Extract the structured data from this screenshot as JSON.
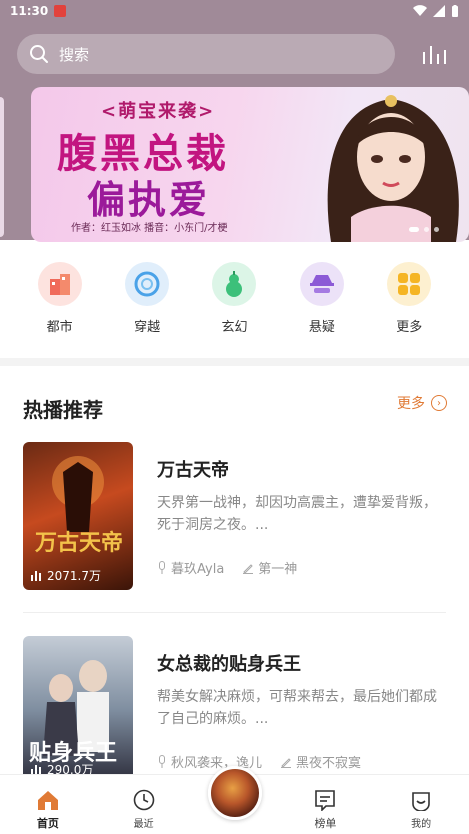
{
  "status": {
    "time": "11:30"
  },
  "search": {
    "placeholder": "搜索"
  },
  "banner": {
    "subtitle": "<萌宝来袭>",
    "title_line1": "腹黑总裁",
    "title_line2": "偏执爱",
    "credit": "作者：红玉如冰    播音：小东门/才梗"
  },
  "categories": [
    {
      "label": "都市",
      "icon": "city-icon",
      "color": "#f06a5a"
    },
    {
      "label": "穿越",
      "icon": "portal-icon",
      "color": "#4aa2e8"
    },
    {
      "label": "玄幻",
      "icon": "gourd-icon",
      "color": "#3cc07a"
    },
    {
      "label": "悬疑",
      "icon": "detective-icon",
      "color": "#8c5ad6"
    },
    {
      "label": "更多",
      "icon": "grid-icon",
      "color": "#f5b524"
    }
  ],
  "section": {
    "title": "热播推荐",
    "more_label": "更多"
  },
  "books": [
    {
      "title": "万古天帝",
      "description": "天界第一战神，却因功高震主，遭挚爱背叛，死于洞房之夜。...",
      "play_count": "2071.7万",
      "author": "暮玖Ayla",
      "narrator": "第一神",
      "cover_colors": [
        "#c64a1f",
        "#3a1408"
      ]
    },
    {
      "title": "女总裁的贴身兵王",
      "description": "帮美女解决麻烦，可帮来帮去，最后她们都成了自己的麻烦。...",
      "play_count": "290.0万",
      "author": "秋风袭来，逸儿",
      "narrator": "黑夜不寂寞",
      "cover_colors": [
        "#9fb0c0",
        "#2a2a38"
      ]
    }
  ],
  "tabs": [
    {
      "label": "首页",
      "icon": "home-icon",
      "active": true
    },
    {
      "label": "最近",
      "icon": "clock-icon",
      "active": false
    },
    {
      "label": "榜单",
      "icon": "ranking-icon",
      "active": false
    },
    {
      "label": "我的",
      "icon": "smile-icon",
      "active": false
    }
  ],
  "colors": {
    "header_bg": "#a08a98",
    "accent": "#e07a35"
  }
}
